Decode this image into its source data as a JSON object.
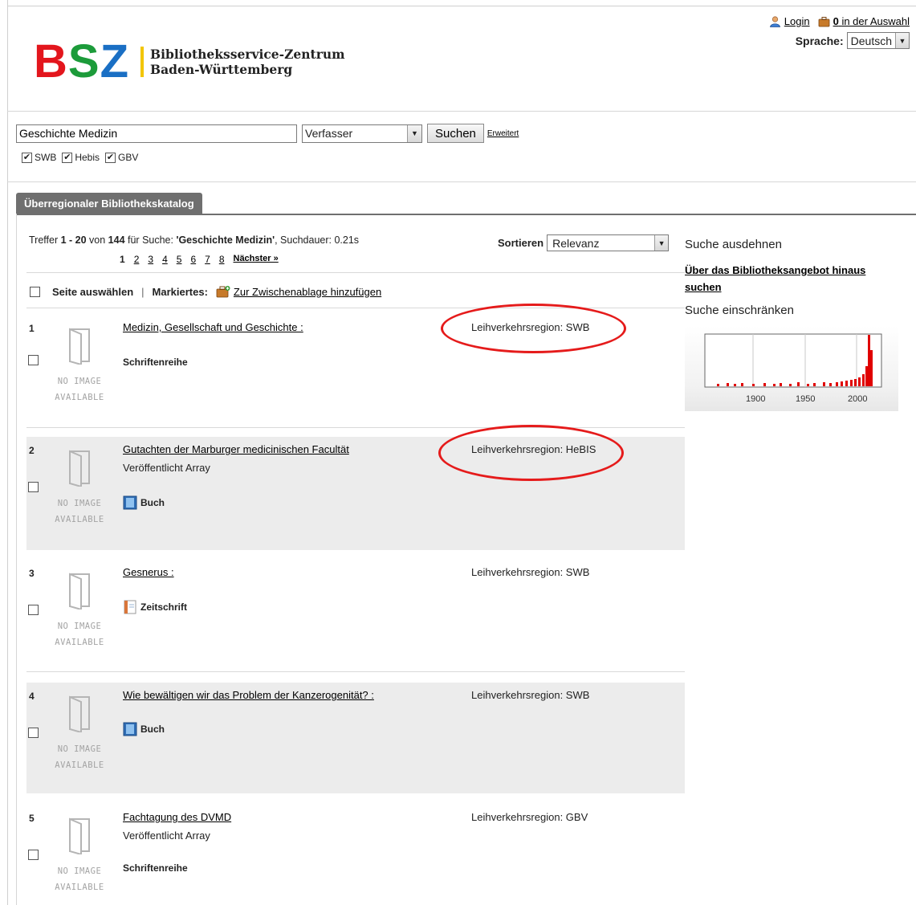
{
  "logo": {
    "letters": [
      "B",
      "S",
      "Z"
    ],
    "letter_colors": [
      "#e3161d",
      "#1c9b3a",
      "#1a6fc4"
    ],
    "line1": "Bibliotheksservice-Zentrum",
    "line2": "Baden-Württemberg"
  },
  "header": {
    "login": "Login",
    "cart_count": "0",
    "cart_label": "in der Auswahl",
    "language_label": "Sprache:",
    "language_value": "Deutsch"
  },
  "search": {
    "query": "Geschichte Medizin",
    "field": "Verfasser",
    "submit": "Suchen",
    "advanced": "Erweitert",
    "sources": [
      {
        "label": "SWB",
        "checked": true
      },
      {
        "label": "Hebis",
        "checked": true
      },
      {
        "label": "GBV",
        "checked": true
      }
    ]
  },
  "tab": {
    "label": "Überregionaler Bibliothekskatalog"
  },
  "results_header": {
    "prefix": "Treffer ",
    "from": "1",
    "dash": " - ",
    "to": "20",
    "of": " von ",
    "total": "144",
    "for": " für Suche: ",
    "query": "'Geschichte Medizin'",
    "duration": ", Suchdauer: 0.21s",
    "pages": [
      "1",
      "2",
      "3",
      "4",
      "5",
      "6",
      "7",
      "8"
    ],
    "next": "Nächster »",
    "sort_label": "Sortieren",
    "sort_value": "Relevanz"
  },
  "selection": {
    "select_page": "Seite auswählen",
    "separator": "|",
    "marked": "Markiertes:",
    "add_clipboard": "Zur Zwischenablage hinzufügen"
  },
  "results": [
    {
      "num": "1",
      "title": "Medizin, Gesellschaft und Geschichte :",
      "sub": "",
      "type": "Schriftenreihe",
      "type_icon": "none",
      "region": "Leihverkehrsregion: SWB",
      "noimg1": "NO IMAGE",
      "noimg2": "AVAILABLE"
    },
    {
      "num": "2",
      "title": "Gutachten der Marburger medicinischen Facultät",
      "sub": "Veröffentlicht Array",
      "type": "Buch",
      "type_icon": "book-icon",
      "region": "Leihverkehrsregion: HeBIS",
      "noimg1": "NO IMAGE",
      "noimg2": "AVAILABLE"
    },
    {
      "num": "3",
      "title": "Gesnerus :",
      "sub": "",
      "type": "Zeitschrift",
      "type_icon": "journal-icon",
      "region": "Leihverkehrsregion: SWB",
      "noimg1": "NO IMAGE",
      "noimg2": "AVAILABLE"
    },
    {
      "num": "4",
      "title": "Wie bewältigen wir das Problem der Kanzerogenität? :",
      "sub": "",
      "type": "Buch",
      "type_icon": "book-icon",
      "region": "Leihverkehrsregion: SWB",
      "noimg1": "NO IMAGE",
      "noimg2": "AVAILABLE"
    },
    {
      "num": "5",
      "title": "Fachtagung des DVMD",
      "sub": "Veröffentlicht Array",
      "type": "Schriftenreihe",
      "type_icon": "none",
      "region": "Leihverkehrsregion: GBV",
      "noimg1": "NO IMAGE",
      "noimg2": "AVAILABLE"
    }
  ],
  "sidebar": {
    "expand_heading": "Suche ausdehnen",
    "expand_link": "Über das Bibliotheksangebot hinaus suchen",
    "narrow_heading": "Suche einschränken",
    "histogram_ticks": [
      "1900",
      "1950",
      "2000"
    ]
  },
  "colors": {
    "accent_red": "#e51b1b",
    "tab_gray": "#6f6f6f",
    "row_shade": "#ececec"
  }
}
